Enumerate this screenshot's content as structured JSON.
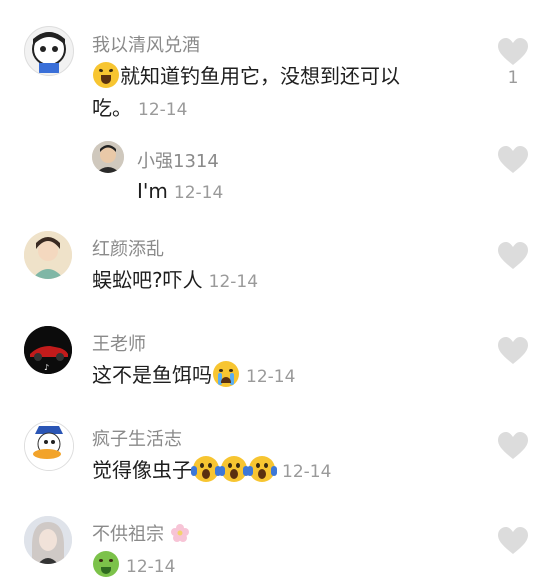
{
  "comments": [
    {
      "username": "我以清风兑酒",
      "line1": "就知道钓鱼用它，没想到还可以",
      "line2": "吃。",
      "timestamp": "12-14",
      "likes": "1",
      "avatar": "cartoon-avatar"
    },
    {
      "username": "小强1314",
      "text": "I'm",
      "timestamp": "12-14",
      "avatar": "man-avatar"
    },
    {
      "username": "红颜添乱",
      "text": "蜈蚣吧?吓人",
      "timestamp": "12-14",
      "avatar": "painting-avatar"
    },
    {
      "username": "王老师",
      "text": "这不是鱼饵吗",
      "timestamp": "12-14",
      "avatar": "car-avatar"
    },
    {
      "username": "疯子生活志",
      "text": "觉得像虫子",
      "timestamp": "12-14",
      "avatar": "duck-avatar"
    },
    {
      "username": "不供祖宗",
      "timestamp": "12-14",
      "avatar": "woman-avatar"
    }
  ],
  "colors": {
    "username": "#8a8a8a",
    "text": "#1e1e1e",
    "timestamp": "#9a9a9a",
    "heart": "#dcdcdc"
  },
  "icons": {
    "like": "heart-icon",
    "laugh": "laughing-emoji-icon",
    "cry": "crying-emoji-icon",
    "scream": "screaming-emoji-icon",
    "sick": "sick-emoji-icon",
    "flower": "cherry-blossom-icon"
  }
}
